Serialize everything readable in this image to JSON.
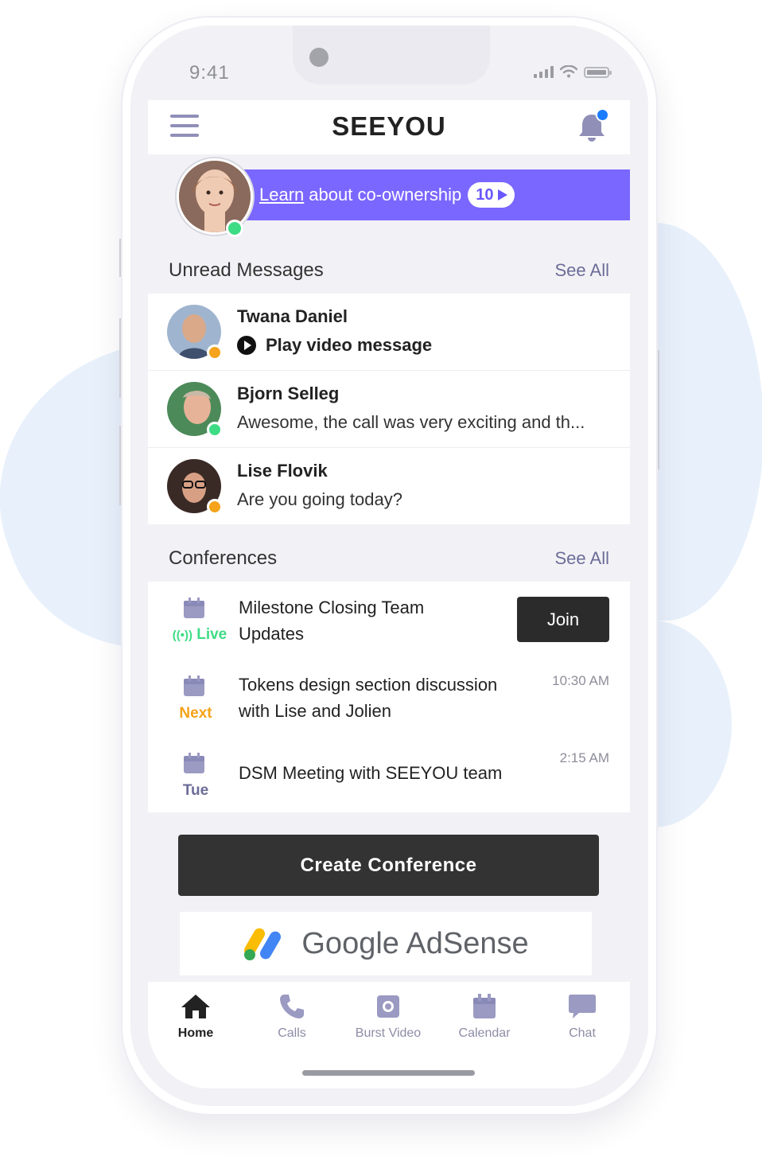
{
  "status_bar": {
    "time": "9:41"
  },
  "header": {
    "brand": "SEEYOU"
  },
  "promo": {
    "link_text": "Learn",
    "text": "about co-ownership",
    "badge_count": "10"
  },
  "unread": {
    "title": "Unread Messages",
    "see_all": "See All",
    "messages": [
      {
        "name": "Twana Daniel",
        "text": "Play video message",
        "status_color": "#f5a31a"
      },
      {
        "name": "Bjorn Selleg",
        "text": "Awesome, the call was very exciting and th...",
        "status_color": "#3ddc84"
      },
      {
        "name": "Lise Flovik",
        "text": "Are you going today?",
        "status_color": "#f5a31a"
      }
    ]
  },
  "conferences": {
    "title": "Conferences",
    "see_all": "See All",
    "items": [
      {
        "status": "Live",
        "title_line1": "Milestone Closing Team",
        "title_line2": "Updates",
        "action": "Join",
        "status_color": "#3ddc84"
      },
      {
        "status": "Next",
        "title_line1": "Tokens design section discussion",
        "title_line2": "with Lise and Jolien",
        "time": "10:30 AM",
        "status_color": "#f5a31a"
      },
      {
        "status": "Tue",
        "title_line1": "DSM Meeting with SEEYOU team",
        "time": "2:15 AM",
        "status_color": "#6c6c99"
      }
    ]
  },
  "create_button": "Create Conference",
  "ad": {
    "text": "Google AdSense"
  },
  "tabs": [
    {
      "label": "Home",
      "icon": "home-icon"
    },
    {
      "label": "Calls",
      "icon": "phone-icon"
    },
    {
      "label": "Burst Video",
      "icon": "camera-icon"
    },
    {
      "label": "Calendar",
      "icon": "calendar-icon"
    },
    {
      "label": "Chat",
      "icon": "chat-icon"
    }
  ],
  "colors": {
    "accent": "#7a67ff",
    "online": "#3ddc84",
    "away": "#f5a31a",
    "dark": "#2b2b2b"
  }
}
